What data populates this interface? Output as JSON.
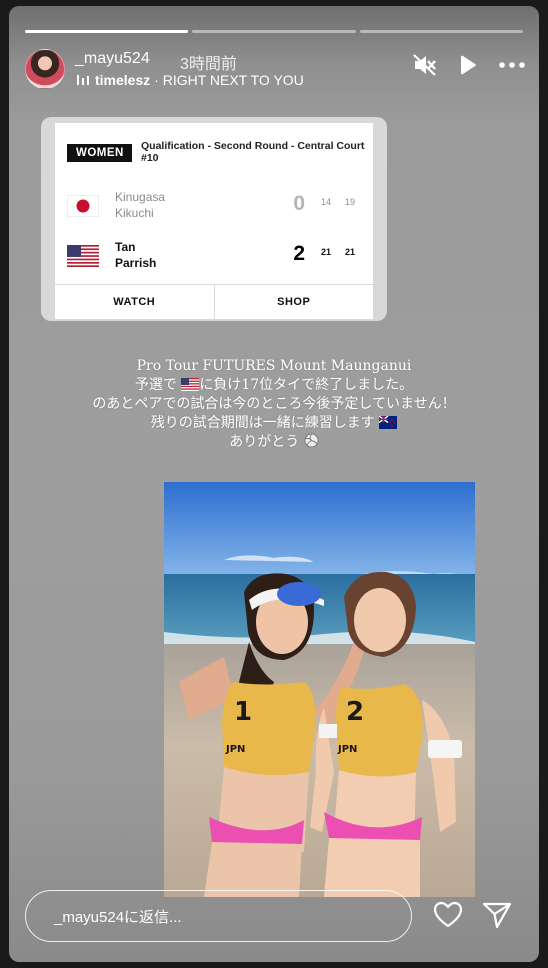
{
  "story": {
    "progress": [
      1,
      0,
      0
    ],
    "username": "_mayu524",
    "time_ago": "3時間前",
    "music": {
      "artist": "timelesz",
      "separator": " · ",
      "song": "RIGHT NEXT TO YOU"
    }
  },
  "scorecard": {
    "badge": "WOMEN",
    "round": "Qualification - Second Round - Central Court #10",
    "teams": [
      {
        "flag": "japan-flag-icon",
        "player1": "Kinugasa",
        "player2": "Kikuchi",
        "score": "0",
        "set1": "14",
        "set2": "19"
      },
      {
        "flag": "usa-flag-icon",
        "player1": "Tan",
        "player2": "Parrish",
        "score": "2",
        "set1": "21",
        "set2": "21"
      }
    ],
    "watch_label": "WATCH",
    "shop_label": "SHOP"
  },
  "caption": {
    "line1": "Pro Tour FUTURES Mount Maunganui",
    "line2_a": "予選で",
    "line2_b": "に負け17位タイで終了しました。",
    "line3": "のあとペアでの試合は今のところ今後予定していません！",
    "line4": "残りの試合期間は一緒に練習します",
    "line5": "ありがとう"
  },
  "photo": {
    "bib_left": "1",
    "bib_right": "2",
    "country": "JPN"
  },
  "footer": {
    "reply_placeholder": "_mayu524に返信..."
  },
  "colors": {
    "jersey": "#e8b84a",
    "bikini": "#ea4fb1",
    "sky": "#3f7fd8",
    "sea": "#2f7fb0",
    "sand": "#cdbfae"
  }
}
